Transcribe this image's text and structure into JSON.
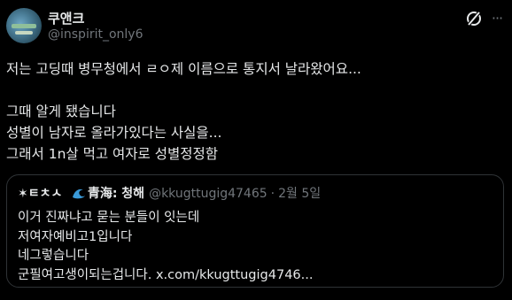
{
  "author": {
    "display_name": "쿠앤크",
    "handle": "@inspirit_only6"
  },
  "icons": {
    "grok": "grok-icon",
    "more": "more-options-icon"
  },
  "post": {
    "lines": [
      "저는 고딩때 병무청에서 ㄹㅇ제 이름으로 통지서 날라왔어요...",
      "",
      "그때 알게 됐습니다",
      "성별이 남자로 올라가있다는 사실을...",
      "그래서 1n살 먹고 여자로 성별정정함"
    ]
  },
  "quoted": {
    "display_name_prefix": "✶ㅌㅊㅅ",
    "display_name_suffix": "青海: 청해",
    "handle": "@kkugttugig47465",
    "separator": "·",
    "date": "2월 5일",
    "lines": [
      "이거 진짜냐고 묻는 분들이 잇는데",
      "저여자예비고1입니다",
      "네그렇습니다",
      "군필여고생이되는겁니다. x.com/kkugttugig4746..."
    ]
  }
}
